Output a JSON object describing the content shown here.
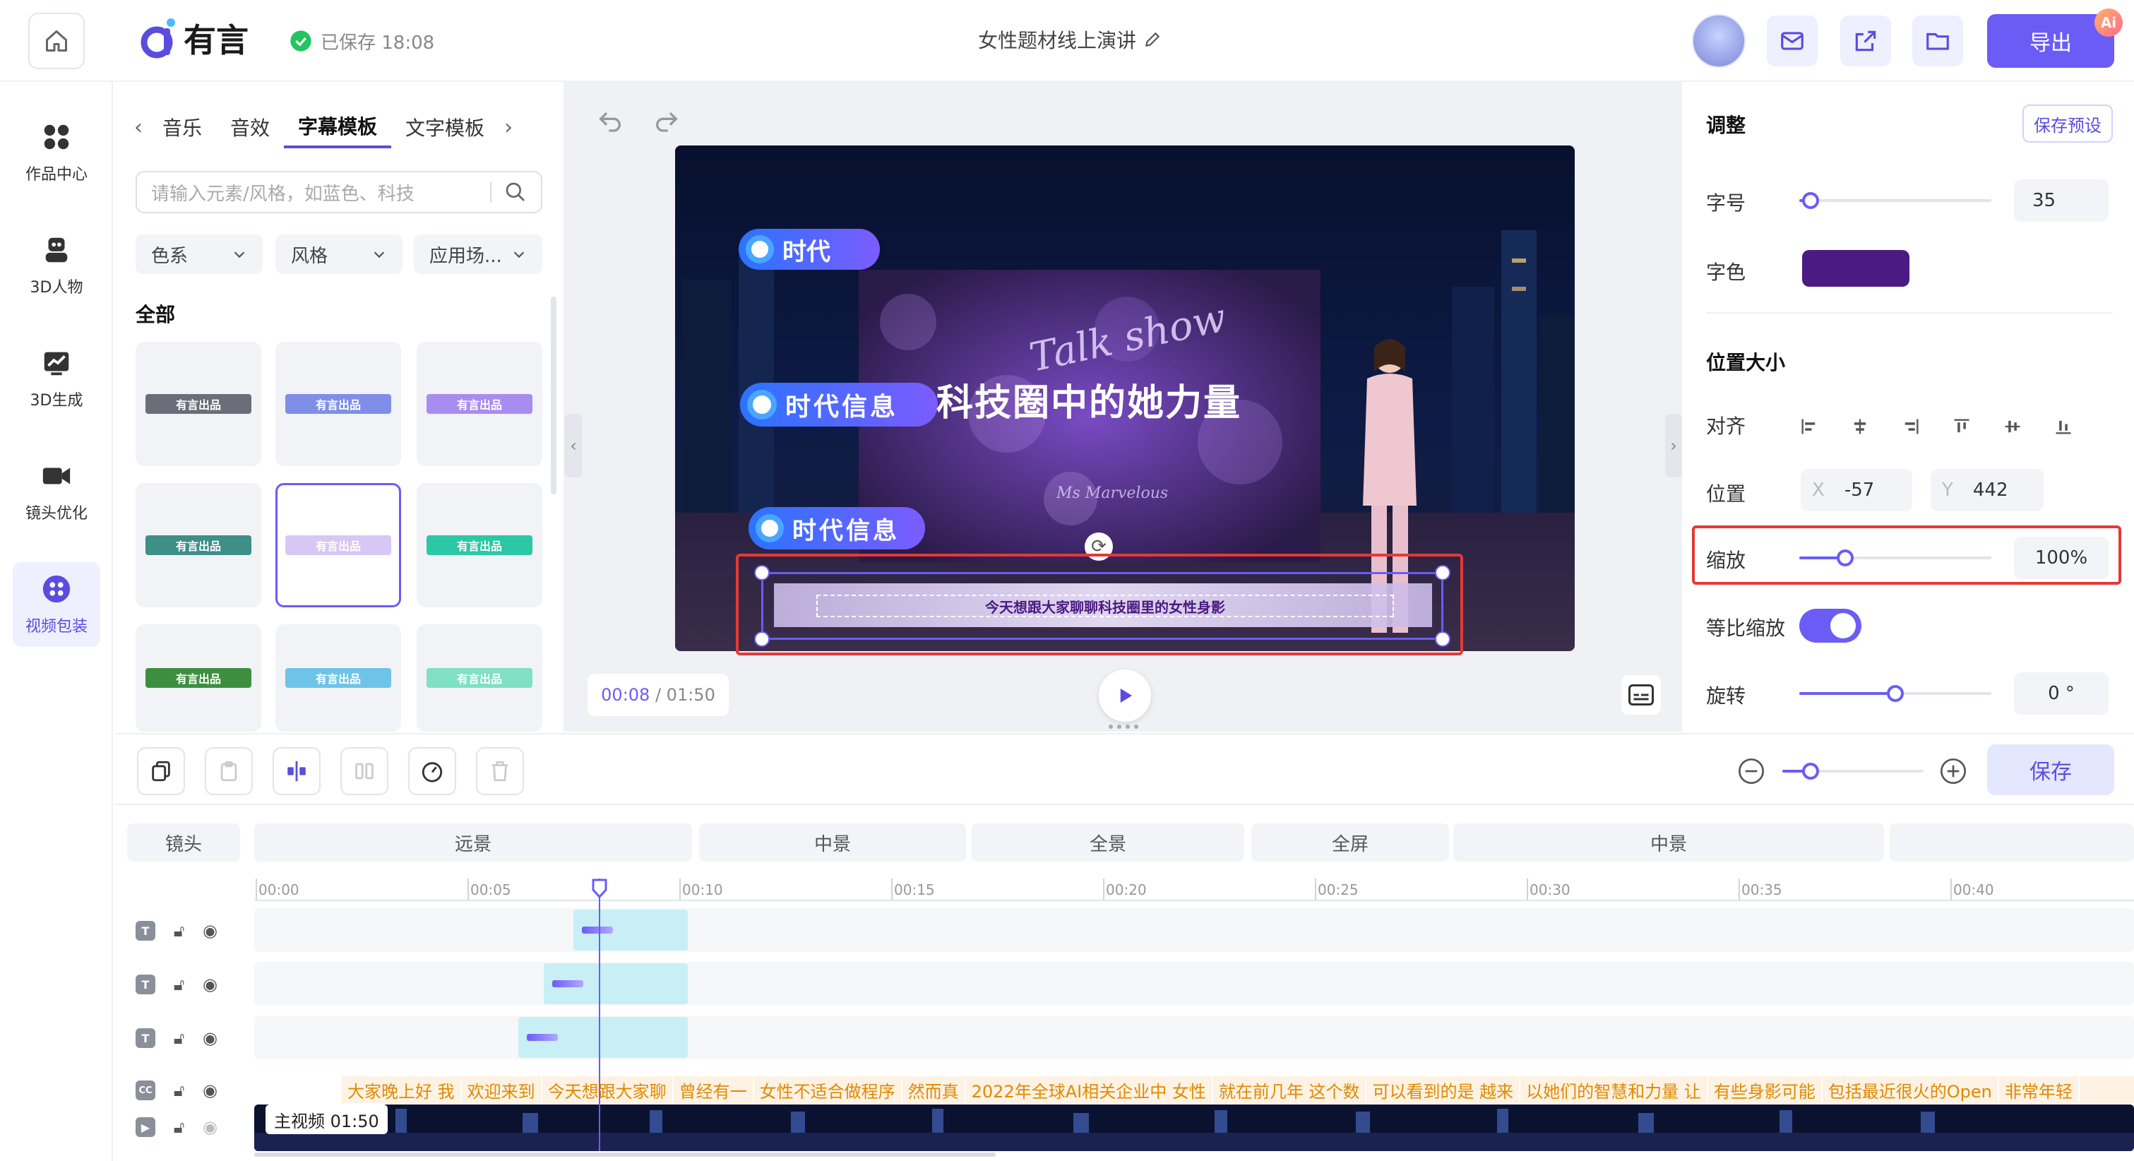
{
  "app": {
    "brand": "有言",
    "saved_status": "已保存 18:08",
    "doc_title": "女性题材线上演讲",
    "export_label": "导出",
    "ai_badge": "Ai"
  },
  "leftnav": {
    "items": [
      {
        "label": "作品中心",
        "icon": "grid-icon"
      },
      {
        "label": "3D人物",
        "icon": "robot-icon"
      },
      {
        "label": "3D生成",
        "icon": "chart-icon"
      },
      {
        "label": "镜头优化",
        "icon": "camera-icon"
      },
      {
        "label": "视频包装",
        "icon": "package-icon"
      }
    ],
    "active_index": 4
  },
  "assets": {
    "tabs": [
      "音乐",
      "音效",
      "字幕模板",
      "文字模板"
    ],
    "active_tab": 2,
    "search_placeholder": "请输入元素/风格，如蓝色、科技",
    "filters": [
      "色系",
      "风格",
      "应用场..."
    ],
    "section": "全部",
    "tile_text": "有言出品",
    "tiles": [
      {
        "style": "#6b6e78"
      },
      {
        "style": "#7f8fe8"
      },
      {
        "style": "#a98cf0"
      },
      {
        "style": "#3d8f87"
      },
      {
        "style": "#d7c7f5"
      },
      {
        "style": "#2cc7a4"
      },
      {
        "style": "#3d8f3f"
      },
      {
        "style": "#6ec4e6"
      },
      {
        "style": "#7fe0c4"
      }
    ],
    "active_tile": 4
  },
  "preview": {
    "captions": {
      "tag1": "时代",
      "tag2": "时代信息",
      "headline": "科技圈中的她力量",
      "tag3": "时代信息",
      "subtitle": "今天想跟大家聊聊科技圈里的女性身影",
      "script_title": "Talk show",
      "script_sign": "Ms Marvelous"
    },
    "time_current": "00:08",
    "time_total": "01:50"
  },
  "props": {
    "heading_adjust": "调整",
    "preset_label": "保存预设",
    "font_size_label": "字号",
    "font_size_value": "35",
    "font_size_fraction": 0.06,
    "font_color_label": "字色",
    "font_color": "#4b1a82",
    "heading_position": "位置大小",
    "align_label": "对齐",
    "position_label": "位置",
    "pos_x_label": "X",
    "pos_x_value": "-57",
    "pos_y_label": "Y",
    "pos_y_value": "442",
    "scale_label": "缩放",
    "scale_value": "100%",
    "scale_fraction": 0.24,
    "lock_ratio_label": "等比缩放",
    "lock_ratio_on": true,
    "rotate_label": "旋转",
    "rotate_value": "0 °",
    "rotate_fraction": 0.5
  },
  "toolbar": {
    "save_label": "保存",
    "zoom_fraction": 0.2
  },
  "timeline": {
    "shot_label": "镜头",
    "shots": [
      "远景",
      "中景",
      "全景",
      "全屏",
      "中景"
    ],
    "ticks": [
      "00:00",
      "00:05",
      "00:10",
      "00:15",
      "00:20",
      "00:25",
      "00:30",
      "00:35",
      "00:40"
    ],
    "track_chip_text": "T",
    "subtitle_chip_text": "CC",
    "subtitles": [
      "大家晚上好 我",
      "欢迎来到",
      "今天想跟大家聊",
      "曾经有一",
      "女性不适合做程序",
      "然而真",
      "2022年全球AI相关企业中 女性",
      "就在前几年 这个数",
      "可以看到的是 越来",
      "以她们的智慧和力量 让",
      "有些身影可能",
      "包括最近很火的Open",
      "非常年轻"
    ],
    "video_label": "主视频 01:50"
  }
}
